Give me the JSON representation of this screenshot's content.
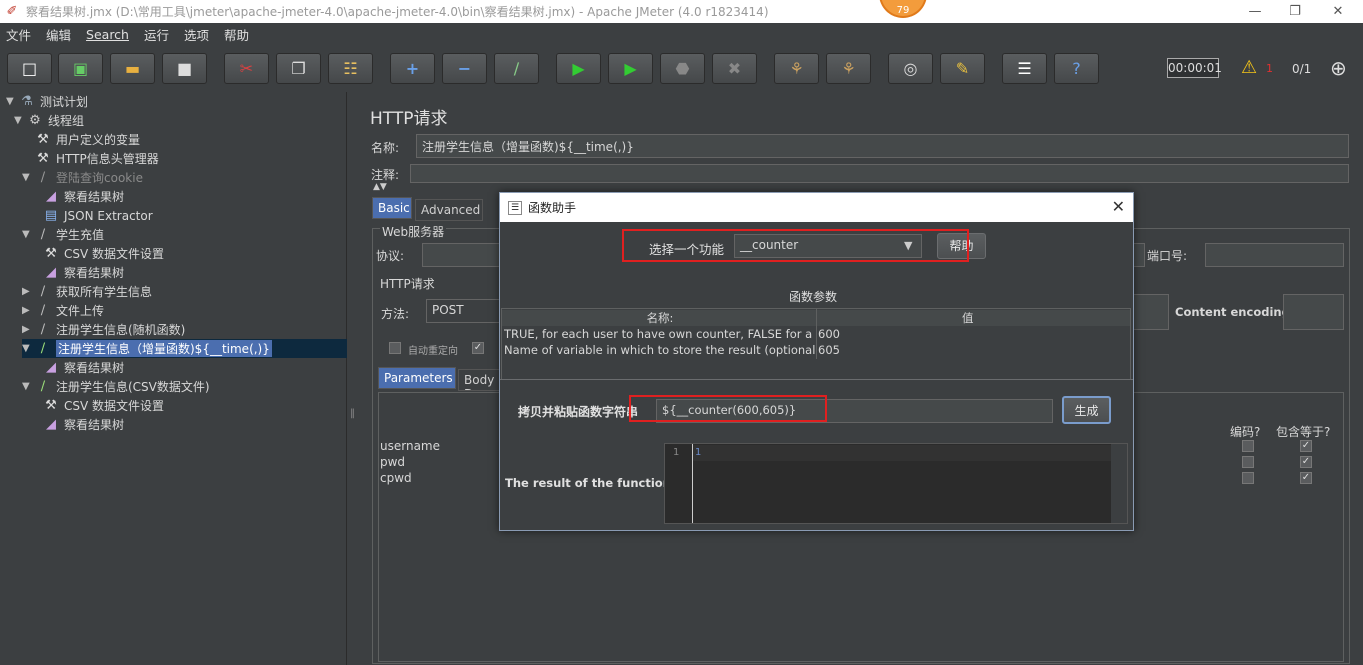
{
  "window": {
    "title": "察看结果树.jmx (D:\\常用工具\\jmeter\\apache-jmeter-4.0\\apache-jmeter-4.0\\bin\\察看结果树.jmx) - Apache JMeter (4.0 r1823414)",
    "badge": "79"
  },
  "menu": [
    "文件",
    "编辑",
    "Search",
    "运行",
    "选项",
    "帮助"
  ],
  "toolbar": {
    "timer": "00:00:01",
    "warnings": "1",
    "threads": "0/1"
  },
  "tree": {
    "items": [
      {
        "label": "测试计划",
        "icon": "flask-icon"
      },
      {
        "label": "线程组",
        "icon": "gear-icon"
      },
      {
        "label": "用户定义的变量",
        "icon": "wrench-icon"
      },
      {
        "label": "HTTP信息头管理器",
        "icon": "wrench-icon"
      },
      {
        "label": "登陆查询cookie",
        "icon": "pipette-icon"
      },
      {
        "label": "察看结果树",
        "icon": "chart-icon"
      },
      {
        "label": "JSON Extractor",
        "icon": "doc-icon"
      },
      {
        "label": "学生充值",
        "icon": "pipette-icon"
      },
      {
        "label": "CSV 数据文件设置",
        "icon": "wrench-icon"
      },
      {
        "label": "察看结果树",
        "icon": "chart-icon"
      },
      {
        "label": "获取所有学生信息",
        "icon": "pipette-icon"
      },
      {
        "label": "文件上传",
        "icon": "pipette-icon"
      },
      {
        "label": "注册学生信息(随机函数)",
        "icon": "pipette-icon"
      },
      {
        "label": "注册学生信息（增量函数)${__time(,)}",
        "icon": "pipette-icon"
      },
      {
        "label": "察看结果树",
        "icon": "chart-icon"
      },
      {
        "label": "注册学生信息(CSV数据文件)",
        "icon": "pipette-icon"
      },
      {
        "label": "CSV 数据文件设置",
        "icon": "wrench-icon"
      },
      {
        "label": "察看结果树",
        "icon": "chart-icon"
      }
    ]
  },
  "main": {
    "title": "HTTP请求",
    "name_label": "名称:",
    "name_value": "注册学生信息（增量函数)${__time(,)}",
    "comment_label": "注释:",
    "tabs": [
      "Basic",
      "Advanced"
    ],
    "web_server": "Web服务器",
    "protocol_label": "协议:",
    "port_label": "端口号:",
    "http_request": "HTTP请求",
    "method_label": "方法:",
    "method_value": "POST",
    "content_encoding": "Content encoding:",
    "auto_redirect": "自动重定向",
    "param_tabs": [
      "Parameters",
      "Body D"
    ],
    "params": [
      "username",
      "pwd",
      "cpwd"
    ],
    "col_encode": "编码?",
    "col_include": "包含等于?"
  },
  "dialog": {
    "title": "函数助手",
    "select_label": "选择一个功能",
    "select_value": "__counter",
    "help_button": "帮助",
    "params_title": "函数参数",
    "col_name": "名称:",
    "col_value": "值",
    "rows": [
      {
        "name": "TRUE, for each user to have own counter, FALSE for a g...",
        "value": "600"
      },
      {
        "name": "Name of variable in which to store the result (optional)",
        "value": "605"
      }
    ],
    "copy_label": "拷贝并粘贴函数字符串",
    "copy_value": "${__counter(600,605)}",
    "generate_button": "生成",
    "result_label": "The result of the function is",
    "line_number": "1",
    "result_value": "1"
  }
}
